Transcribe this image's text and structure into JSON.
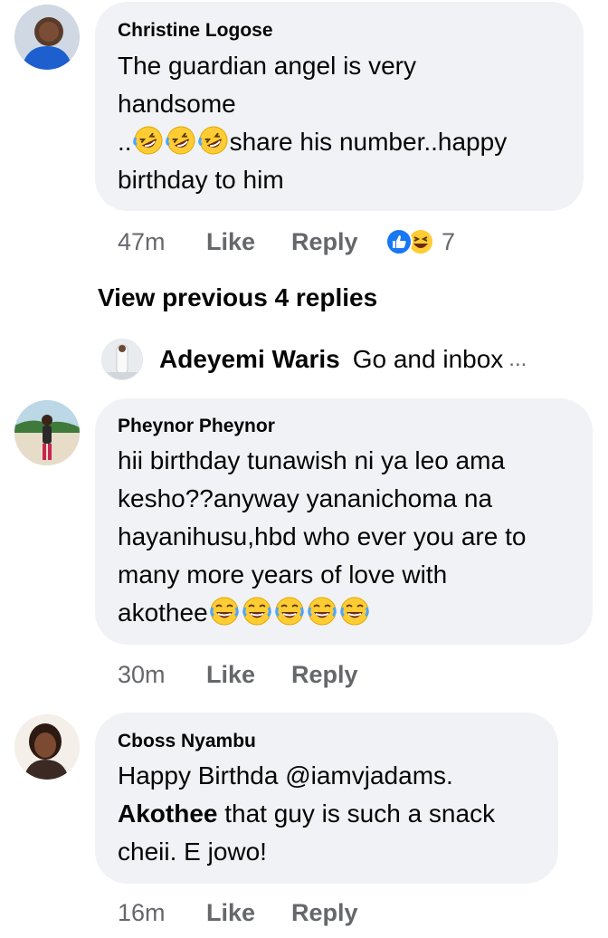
{
  "comments": [
    {
      "author": "Christine Logose",
      "lines": [
        "The guardian angel is very",
        "handsome"
      ],
      "line3_prefix": "..",
      "line3_suffix": "share his number..happy",
      "line4": "birthday to him",
      "time": "47m",
      "like": "Like",
      "reply": "Reply",
      "reaction_count": "7"
    },
    {
      "author": "Pheynor Pheynor",
      "lines": [
        "hii birthday tunawish ni ya leo ama",
        "kesho??anyway yananichoma na",
        "hayanihusu,hbd who ever you are to",
        "many more years of love with"
      ],
      "line5": "akothee",
      "time": "30m",
      "like": "Like",
      "reply": "Reply"
    },
    {
      "author": "Cboss Nyambu",
      "line1": "Happy Birthda @iamvjadams.",
      "bold_word": "Akothee",
      "line2_rest": " that guy is such a snack",
      "line3": "cheii. E jowo!",
      "time": "16m",
      "like": "Like",
      "reply": "Reply"
    }
  ],
  "view_previous": "View previous 4 replies",
  "reply_preview": {
    "author": "Adeyemi Waris",
    "text": "Go and inbox",
    "ellipsis": "..."
  },
  "icons": {
    "laugh_emoji": "rolling-on-floor-laughing",
    "tears_emoji": "face-with-tears-of-joy",
    "like_reaction": "thumbs-up",
    "haha_reaction": "squinting-laugh"
  },
  "colors": {
    "bubble": "#f0f2f5",
    "meta": "#65676b",
    "like_blue": "#1877f2",
    "emoji_yellow": "#ffcc33"
  }
}
